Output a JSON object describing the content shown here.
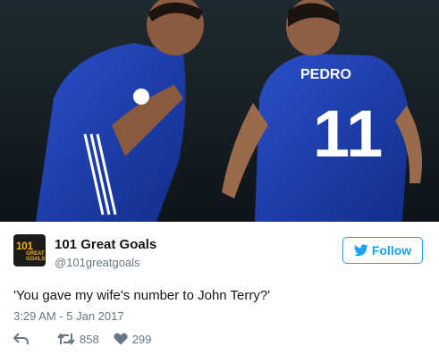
{
  "tweet": {
    "photo": {
      "jersey_name": "PEDRO",
      "jersey_number": "11",
      "description_icons": [
        "player-left",
        "player-right"
      ]
    },
    "author": {
      "avatar_line1": "101",
      "avatar_line2": "GREAT GOALS",
      "display_name": "101 Great Goals",
      "handle": "@101greatgoals"
    },
    "follow_label": "Follow",
    "text": "'You gave my wife's number to John Terry?'",
    "timestamp": "3:29 AM - 5 Jan 2017",
    "actions": {
      "reply_icon": "reply-icon",
      "retweet_icon": "retweet-icon",
      "retweet_count": "858",
      "like_icon": "heart-icon",
      "like_count": "299"
    },
    "colors": {
      "accent": "#1da1f2",
      "secondary_text": "#657786",
      "primary_text": "#14171a"
    }
  }
}
